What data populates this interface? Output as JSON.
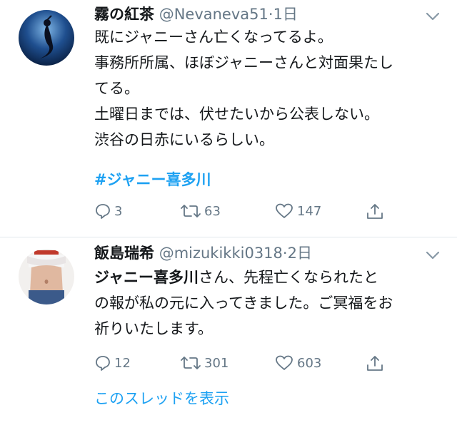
{
  "tweets": [
    {
      "name": "霧の紅茶",
      "handle": "@Nevaneva51",
      "time": "1日",
      "lines": "既にジャニーさん亡くなってるよ。\n事務所所属、ほぼジャニーさんと対面果たし\nてる。\n土曜日までは、伏せたいから公表しない。\n渋谷の日赤にいるらしい。",
      "hashtag": "#ジャニー喜多川",
      "replies": "3",
      "retweets": "63",
      "likes": "147"
    },
    {
      "name": "飯島瑞希",
      "handle": "@mizukikki0318",
      "time": "2日",
      "bold_prefix": "ジャニー喜多川",
      "line1_rest": "さん、先程亡くなられたと",
      "line2": "の報が私の元に入ってきました。ご冥福をお",
      "line3": "祈りいたします。",
      "replies": "12",
      "retweets": "301",
      "likes": "603",
      "thread_link": "このスレッドを表示"
    }
  ],
  "colors": {
    "accent": "#1da1f2",
    "muted": "#657786",
    "text": "#14171a",
    "divider": "#e1e8ed"
  }
}
